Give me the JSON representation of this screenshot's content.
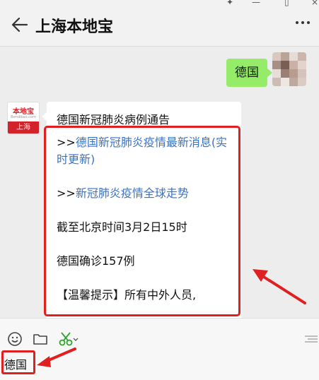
{
  "header": {
    "title": "上海本地宝"
  },
  "chat": {
    "outgoing": {
      "text": "德国"
    },
    "incoming": {
      "title": "德国新冠肺炎病例通告",
      "link1_prefix": ">>",
      "link1_text": "德国新冠肺炎疫情最新消息(实时更新)",
      "link2_prefix": ">>",
      "link2_text": "新冠肺炎疫情全球走势",
      "line3": "截至北京时间3月2日15时",
      "line4": "德国确诊157例",
      "line5": "【温馨提示】所有中外人员,"
    },
    "brand_avatar": {
      "logo": "本地宝",
      "sub": "Bendibao.com",
      "city": "上海"
    }
  },
  "input": {
    "value": "德国"
  },
  "colors": {
    "accent_red": "#e02020",
    "bubble_green": "#95ec69",
    "link_blue": "#3a73c8"
  },
  "icons": [
    "back-arrow-icon",
    "more-dots-icon",
    "emoji-icon",
    "folder-icon",
    "scissors-icon",
    "pin-icon",
    "maximize-icon",
    "minimize-icon"
  ]
}
